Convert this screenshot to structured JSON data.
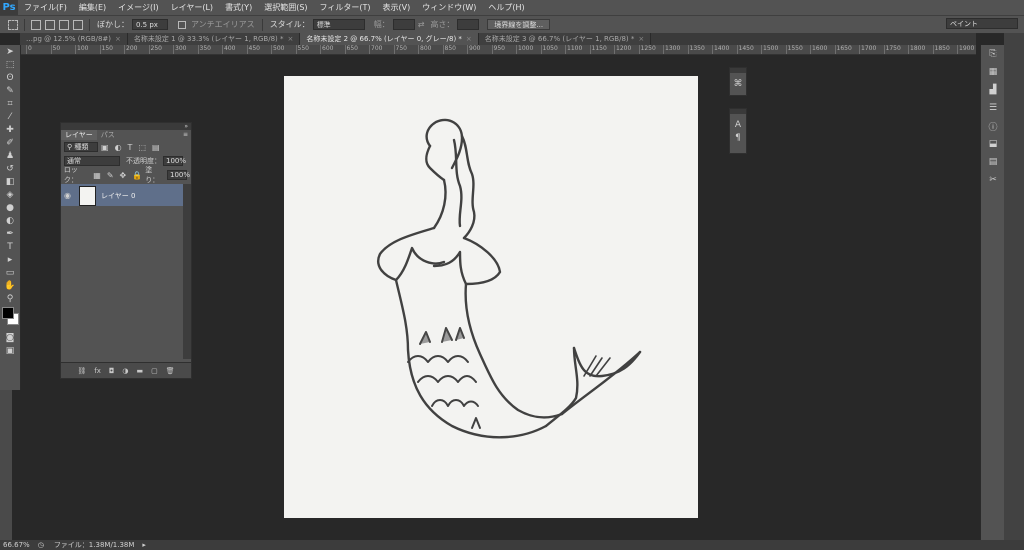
{
  "app": {
    "logo": "Ps"
  },
  "menubar": {
    "items": [
      "ファイル(F)",
      "編集(E)",
      "イメージ(I)",
      "レイヤー(L)",
      "書式(Y)",
      "選択範囲(S)",
      "フィルター(T)",
      "表示(V)",
      "ウィンドウ(W)",
      "ヘルプ(H)"
    ]
  },
  "options": {
    "feather_label": "ぼかし：",
    "feather_value": "0.5 px",
    "antialias_label": "アンチエイリアス",
    "style_label": "スタイル：",
    "style_value": "標準",
    "width_label": "幅：",
    "height_label": "高さ：",
    "refine_edge_button": "境界線を調整...",
    "workspace": "ペイント"
  },
  "tabs": [
    {
      "label": "…pg @ 12.5% (RGB/8#)",
      "active": false
    },
    {
      "label": "名称未設定 1 @ 33.3% (レイヤー 1, RGB/8) *",
      "active": false
    },
    {
      "label": "名称未設定 2 @ 66.7% (レイヤー 0, グレー/8) *",
      "active": true
    },
    {
      "label": "名称未設定 3 @ 66.7% (レイヤー 1, RGB/8) *",
      "active": false
    }
  ],
  "ruler": {
    "ticks": [
      "0",
      "50",
      "100",
      "150",
      "200",
      "250",
      "300",
      "350",
      "400",
      "450",
      "500",
      "550",
      "600",
      "650",
      "700",
      "750",
      "800",
      "850",
      "900",
      "950",
      "1000",
      "1050",
      "1100",
      "1150",
      "1200",
      "1250",
      "1300",
      "1350",
      "1400",
      "1450",
      "1500",
      "1550",
      "1600",
      "1650",
      "1700",
      "1750",
      "1800",
      "1850",
      "1900"
    ]
  },
  "layers_panel": {
    "tab_layers": "レイヤー",
    "tab_paths": "パス",
    "filter_kind": "種類",
    "blend_mode": "通常",
    "opacity_label": "不透明度：",
    "opacity_value": "100%",
    "lock_label": "ロック：",
    "fill_label": "塗り：",
    "fill_value": "100%",
    "layers": [
      {
        "name": "レイヤー 0",
        "visible": true
      }
    ]
  },
  "status": {
    "zoom": "66.67%",
    "file_info": "ファイル：1.38M/1.38M"
  },
  "colors": {
    "foreground": "#000000",
    "background": "#ffffff",
    "accent": "#31a8ff"
  }
}
